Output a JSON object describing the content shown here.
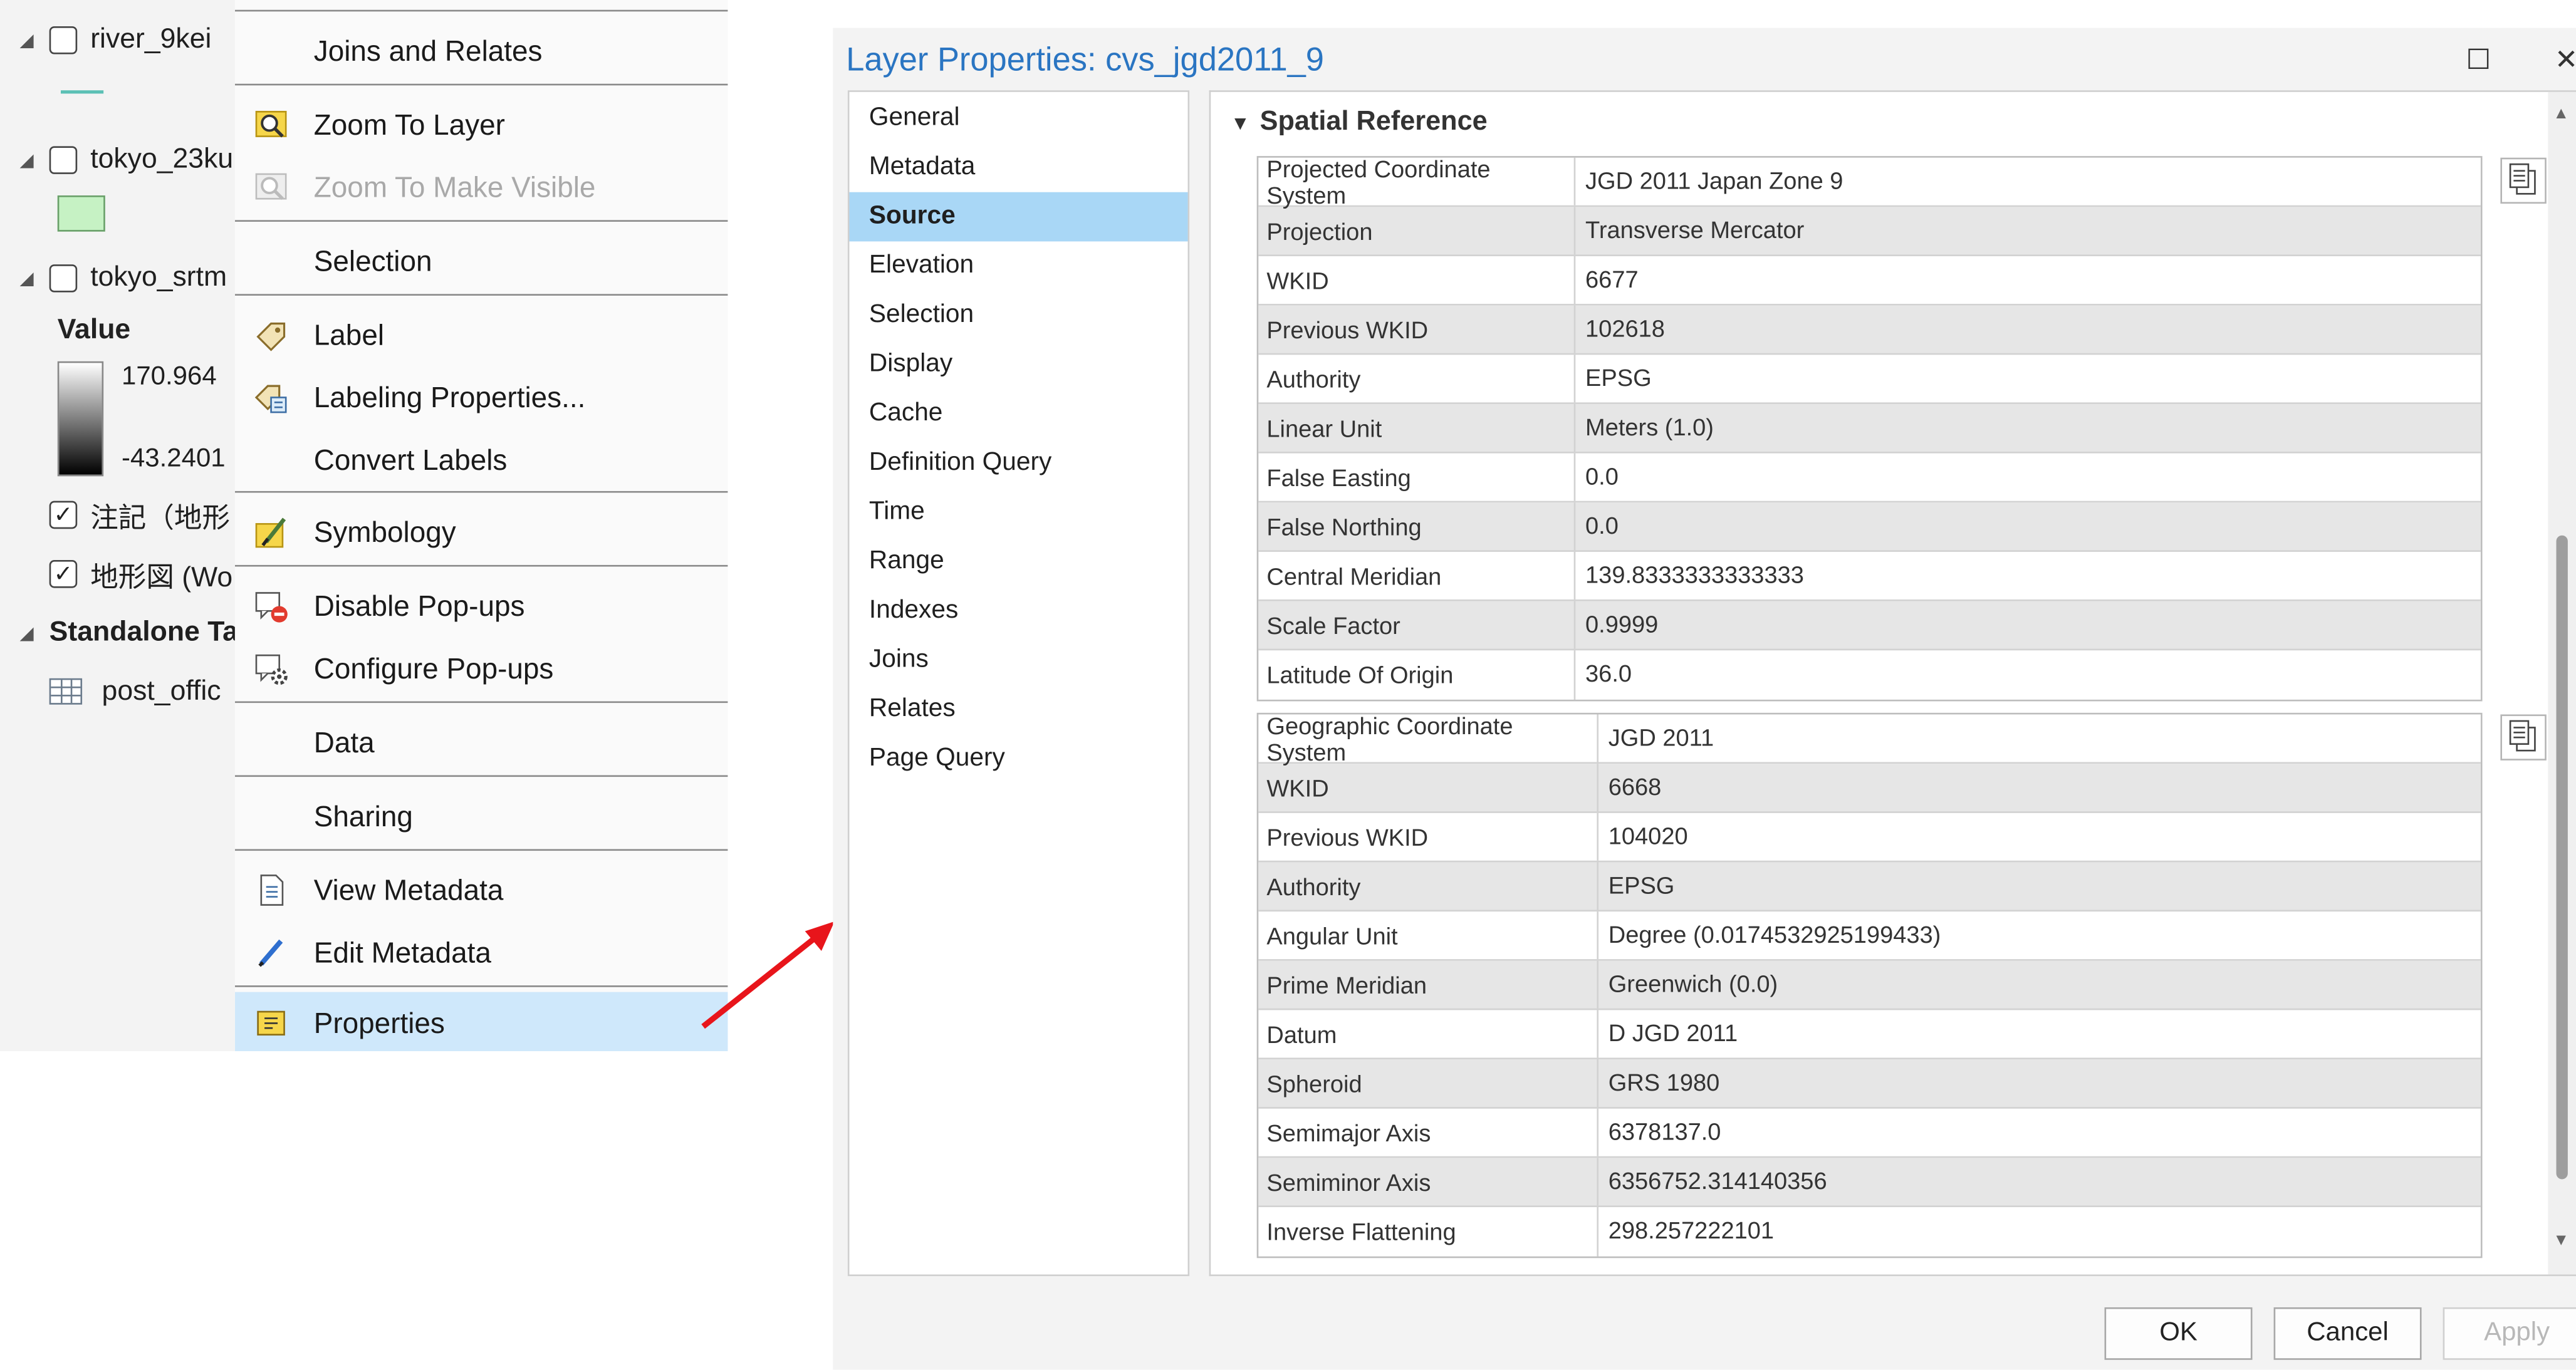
{
  "contents_pane": {
    "layers": [
      {
        "name": "river_9kei",
        "checked": false
      },
      {
        "name": "tokyo_23ku",
        "checked": false
      },
      {
        "name": "tokyo_srtm",
        "checked": false
      }
    ],
    "legend_value_label": "Value",
    "ramp_max": "170.964",
    "ramp_min": "-43.2401",
    "basemap_annotation": "注記（地形",
    "basemap_topo": "地形図 (Wo",
    "standalone_tables_label": "Standalone Ta",
    "table_name": "post_offic"
  },
  "context_menu": {
    "joins_and_relates": "Joins and Relates",
    "zoom_to_layer": "Zoom To Layer",
    "zoom_to_make_visible": "Zoom To Make Visible",
    "selection": "Selection",
    "label": "Label",
    "labeling_properties": "Labeling Properties...",
    "convert_labels": "Convert Labels",
    "symbology": "Symbology",
    "disable_popups": "Disable Pop-ups",
    "configure_popups": "Configure Pop-ups",
    "data": "Data",
    "sharing": "Sharing",
    "view_metadata": "View Metadata",
    "edit_metadata": "Edit Metadata",
    "properties": "Properties"
  },
  "dialog": {
    "title": "Layer Properties: cvs_jgd2011_9",
    "maximize_glyph": "☐",
    "close_glyph": "✕",
    "categories": [
      "General",
      "Metadata",
      "Source",
      "Elevation",
      "Selection",
      "Display",
      "Cache",
      "Definition Query",
      "Time",
      "Range",
      "Indexes",
      "Joins",
      "Relates",
      "Page Query"
    ],
    "selected_category": "Source",
    "section_title": "Spatial Reference",
    "projected": [
      {
        "key": "Projected Coordinate System",
        "value": "JGD 2011 Japan Zone  9"
      },
      {
        "key": "Projection",
        "value": "Transverse Mercator"
      },
      {
        "key": "WKID",
        "value": "6677"
      },
      {
        "key": "Previous WKID",
        "value": "102618"
      },
      {
        "key": "Authority",
        "value": "EPSG"
      },
      {
        "key": "Linear Unit",
        "value": "Meters (1.0)"
      },
      {
        "key": "False Easting",
        "value": "0.0"
      },
      {
        "key": "False Northing",
        "value": "0.0"
      },
      {
        "key": "Central Meridian",
        "value": "139.8333333333333"
      },
      {
        "key": "Scale Factor",
        "value": "0.9999"
      },
      {
        "key": "Latitude Of Origin",
        "value": "36.0"
      }
    ],
    "geographic": [
      {
        "key": "Geographic Coordinate System",
        "value": "JGD 2011"
      },
      {
        "key": "WKID",
        "value": "6668"
      },
      {
        "key": "Previous WKID",
        "value": "104020"
      },
      {
        "key": "Authority",
        "value": "EPSG"
      },
      {
        "key": "Angular Unit",
        "value": "Degree (0.0174532925199433)"
      },
      {
        "key": "Prime Meridian",
        "value": "Greenwich (0.0)"
      },
      {
        "key": "Datum",
        "value": "D JGD 2011"
      },
      {
        "key": "Spheroid",
        "value": "GRS 1980"
      },
      {
        "key": "Semimajor Axis",
        "value": "6378137.0"
      },
      {
        "key": "Semiminor Axis",
        "value": "6356752.314140356"
      },
      {
        "key": "Inverse Flattening",
        "value": "298.257222101"
      }
    ],
    "buttons": {
      "ok": "OK",
      "cancel": "Cancel",
      "apply": "Apply"
    }
  },
  "colors": {
    "title_blue": "#2a75c2",
    "selection_blue": "#a9d7f6",
    "menu_highlight": "#cfe8fb",
    "arrow_red": "#e8151b"
  }
}
